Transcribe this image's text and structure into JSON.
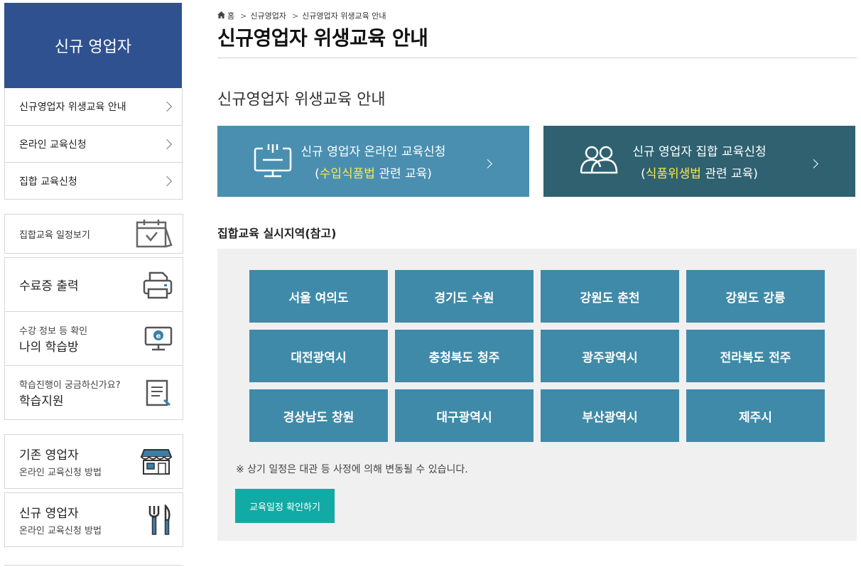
{
  "sidebar": {
    "title": "신규 영업자",
    "menu": [
      {
        "label": "신규영업자 위생교육 안내"
      },
      {
        "label": "온라인 교육신청"
      },
      {
        "label": "집합 교육신청"
      }
    ],
    "schedule": {
      "label": "집합교육 일정보기",
      "icon": "calendar-check-icon"
    },
    "certificate": {
      "label": "수료증 출력",
      "icon": "printer-icon"
    },
    "myroom": {
      "small": "수강 정보 등 확인",
      "big": "나의 학습방",
      "icon": "monitor-e-icon"
    },
    "support": {
      "small": "학습진행이 궁금하신가요?",
      "big": "학습지원",
      "icon": "document-pen-icon"
    },
    "existing": {
      "big": "기존 영업자",
      "small": "온라인 교육신청 방법",
      "icon": "storefront-icon"
    },
    "new": {
      "big": "신규 영업자",
      "small": "온라인 교육신청 방법",
      "icon": "fork-knife-icon"
    }
  },
  "breadcrumb": {
    "home": "홈",
    "level1": "신규영업자",
    "level2": "신규영업자 위생교육 안내"
  },
  "page_title": "신규영업자 위생교육 안내",
  "section_title": "신규영업자 위생교육 안내",
  "apply": {
    "online": {
      "line1": "신규 영업자 온라인 교육신청",
      "open": "(",
      "highlight": "수입식품법",
      "rest": " 관련 교육)",
      "icon": "online-monitor-icon",
      "color": "#4a8fb0"
    },
    "group": {
      "line1": "신규 영업자 집합 교육신청",
      "open": "(",
      "highlight": "식품위생법",
      "rest": " 관련 교육)",
      "icon": "people-group-icon",
      "color": "#2f6170"
    },
    "highlight_color": "#ffe94a"
  },
  "region_title": "집합교육 실시지역(참고)",
  "regions": [
    "서울 여의도",
    "경기도 수원",
    "강원도 춘천",
    "강원도 강릉",
    "대전광역시",
    "충청북도 청주",
    "광주광역시",
    "전라북도 전주",
    "경상남도 창원",
    "대구광역시",
    "부산광역시",
    "제주시"
  ],
  "notice": "※ 상기 일정은 대관 등 사정에 의해 변동될 수 있습니다.",
  "schedule_button": "교육일정 확인하기",
  "colors": {
    "sidebar_header": "#2f5190",
    "region_button": "#3f8aa9",
    "schedule_button": "#12aaa4"
  }
}
